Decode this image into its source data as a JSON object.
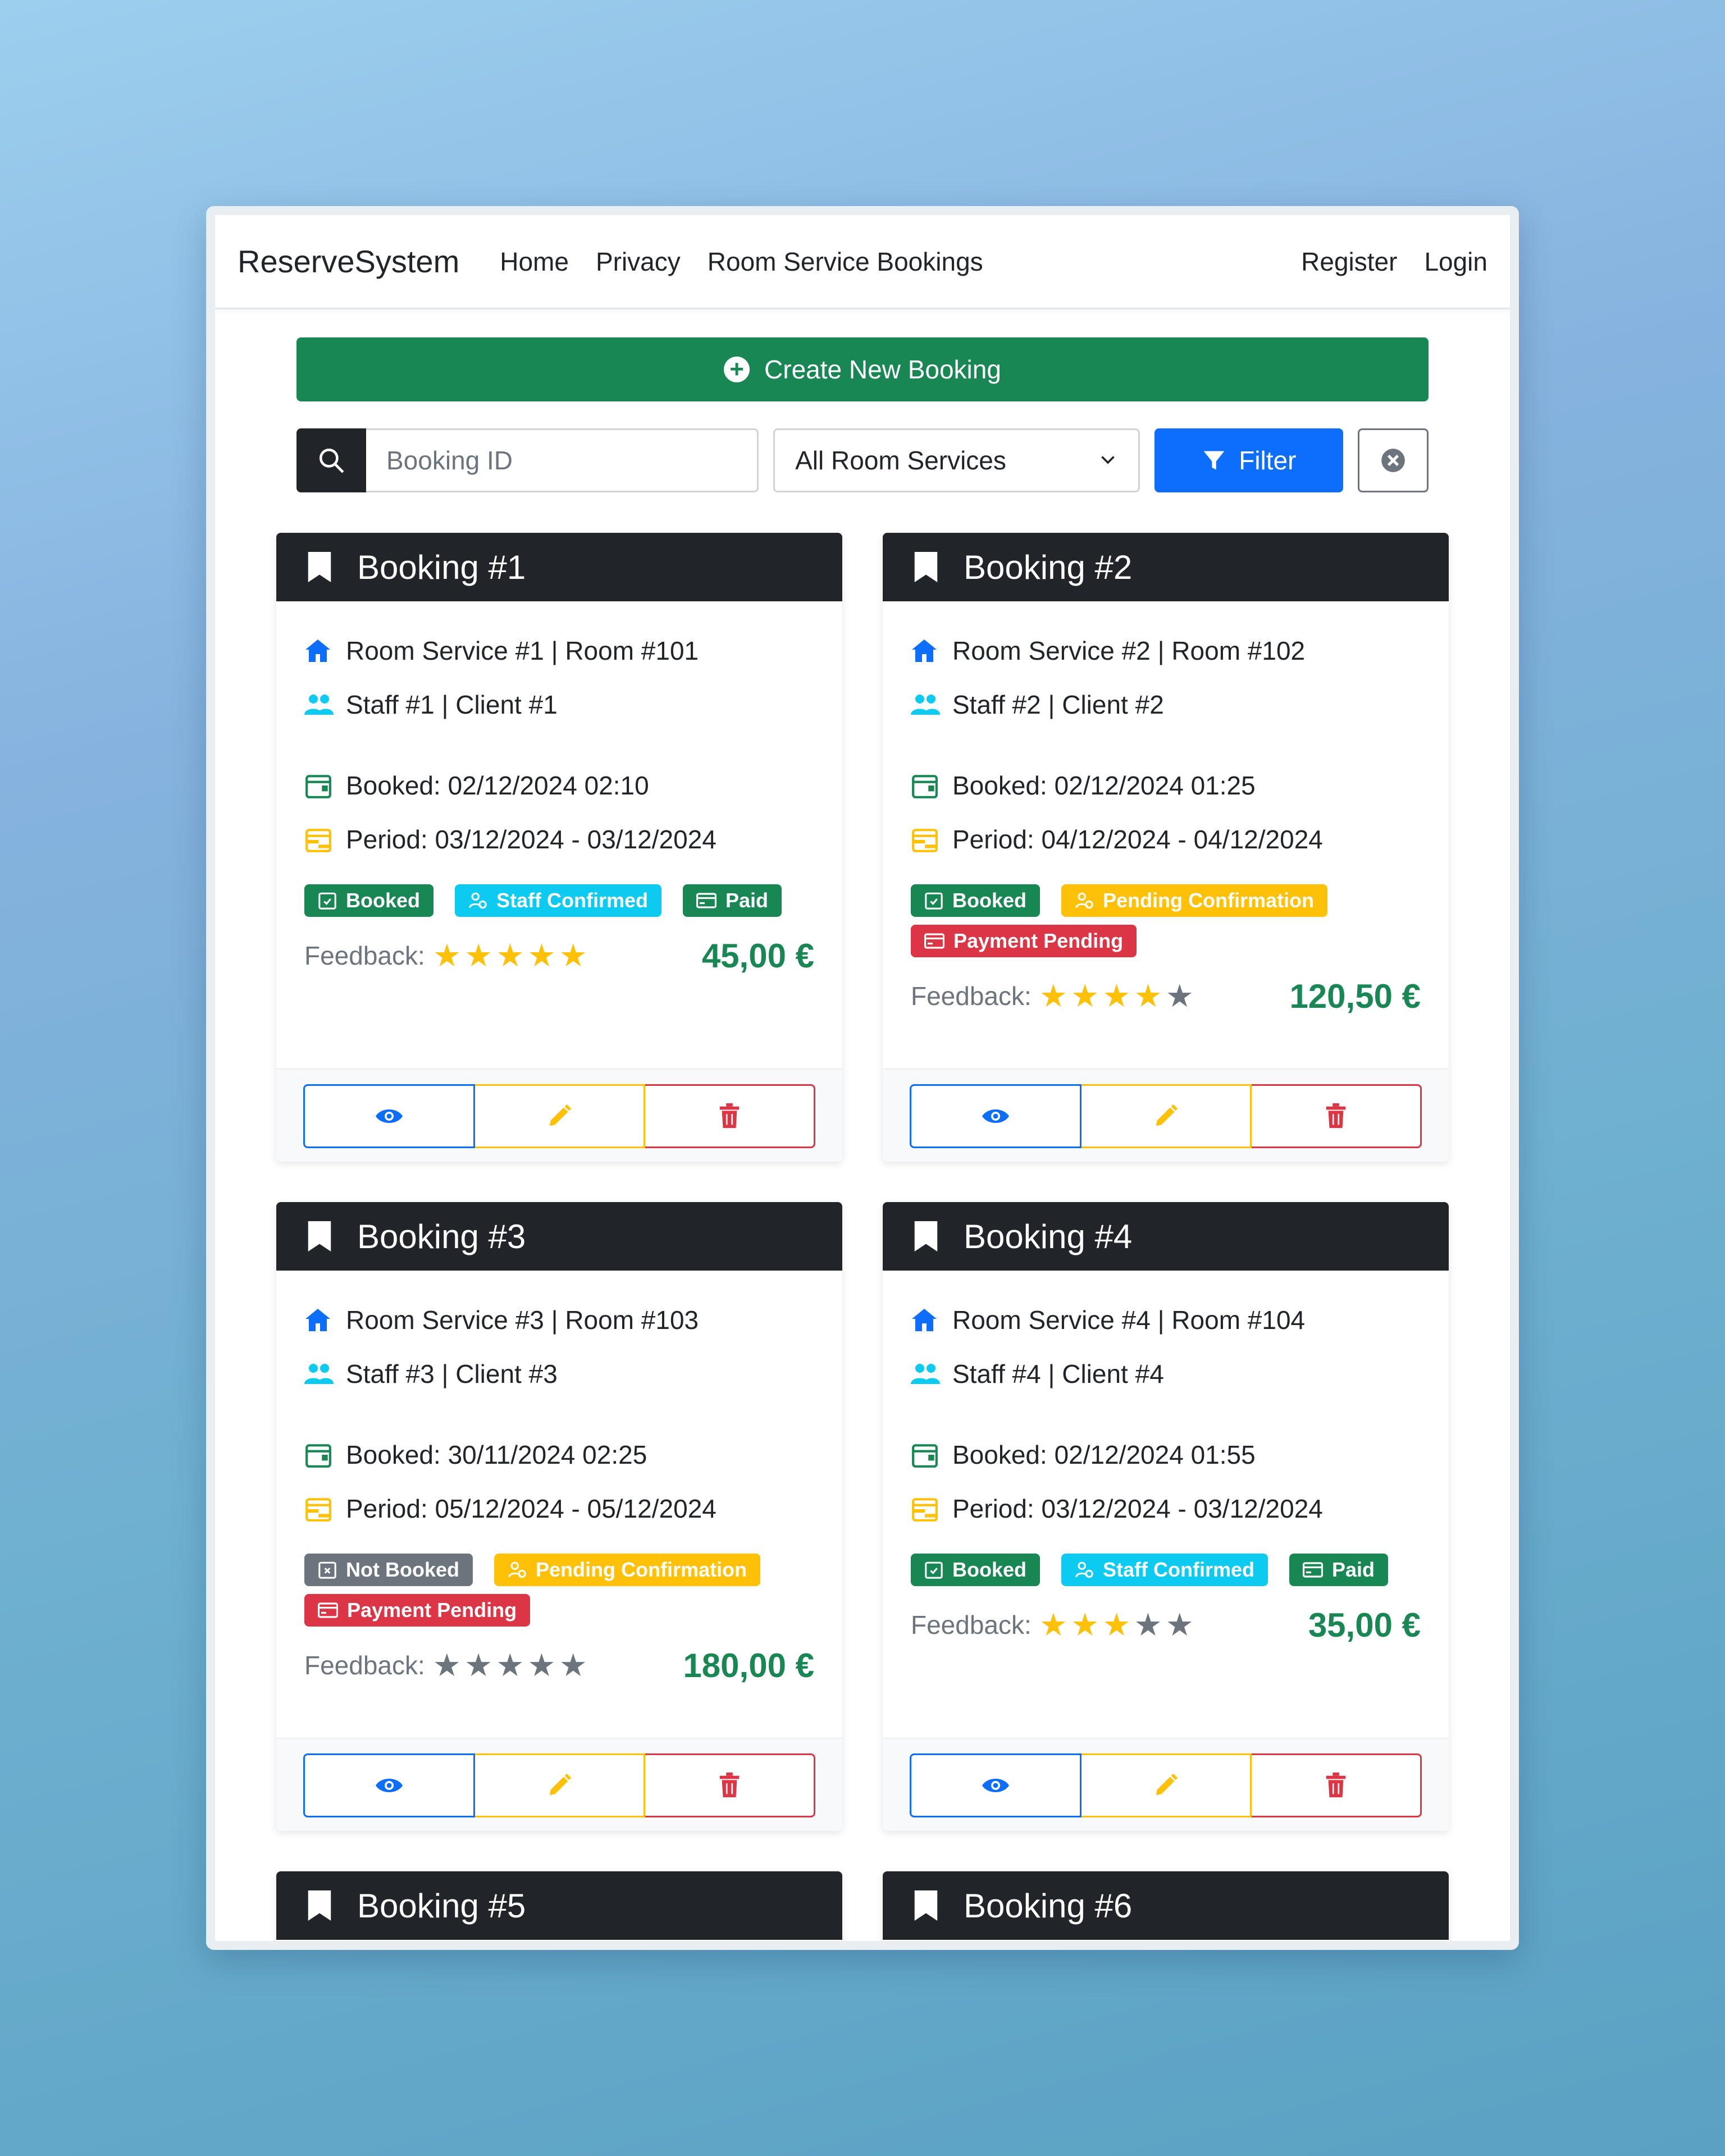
{
  "navbar": {
    "brand": "ReserveSystem",
    "links": [
      "Home",
      "Privacy",
      "Room Service Bookings"
    ],
    "right_links": [
      "Register",
      "Login"
    ]
  },
  "actions": {
    "create_label": "Create New Booking"
  },
  "filters": {
    "search_placeholder": "Booking ID",
    "search_value": "",
    "room_service_selected": "All Room Services",
    "filter_label": "Filter"
  },
  "feedback_label": "Feedback:",
  "colors": {
    "primary": "#0d6efd",
    "success": "#198754",
    "warning": "#ffc107",
    "danger": "#dc3545",
    "info": "#0dcaf0",
    "dark": "#212529",
    "secondary": "#6c757d"
  },
  "bookings": [
    {
      "title": "Booking #1",
      "service_room": "Room Service #1 | Room #101",
      "staff_client": "Staff #1 | Client #1",
      "booked": "Booked: 02/12/2024 02:10",
      "period": "Period: 03/12/2024 - 03/12/2024",
      "badges": [
        {
          "label": "Booked",
          "color": "green",
          "icon": "calendar-check-icon"
        },
        {
          "label": "Staff Confirmed",
          "color": "cyan",
          "icon": "person-check-icon"
        },
        {
          "label": "Paid",
          "color": "green",
          "icon": "credit-card-icon"
        }
      ],
      "rating": 5,
      "price": "45,00 €"
    },
    {
      "title": "Booking #2",
      "service_room": "Room Service #2 | Room #102",
      "staff_client": "Staff #2 | Client #2",
      "booked": "Booked: 02/12/2024 01:25",
      "period": "Period: 04/12/2024 - 04/12/2024",
      "badges": [
        {
          "label": "Booked",
          "color": "green",
          "icon": "calendar-check-icon"
        },
        {
          "label": "Pending Confirmation",
          "color": "yellow",
          "icon": "person-clock-icon"
        },
        {
          "label": "Payment Pending",
          "color": "red",
          "icon": "credit-card-icon"
        }
      ],
      "rating": 4,
      "price": "120,50 €"
    },
    {
      "title": "Booking #3",
      "service_room": "Room Service #3 | Room #103",
      "staff_client": "Staff #3 | Client #3",
      "booked": "Booked: 30/11/2024 02:25",
      "period": "Period: 05/12/2024 - 05/12/2024",
      "badges": [
        {
          "label": "Not Booked",
          "color": "gray",
          "icon": "calendar-x-icon"
        },
        {
          "label": "Pending Confirmation",
          "color": "yellow",
          "icon": "person-clock-icon"
        },
        {
          "label": "Payment Pending",
          "color": "red",
          "icon": "credit-card-icon"
        }
      ],
      "rating": 0,
      "price": "180,00 €"
    },
    {
      "title": "Booking #4",
      "service_room": "Room Service #4 | Room #104",
      "staff_client": "Staff #4 | Client #4",
      "booked": "Booked: 02/12/2024 01:55",
      "period": "Period: 03/12/2024 - 03/12/2024",
      "badges": [
        {
          "label": "Booked",
          "color": "green",
          "icon": "calendar-check-icon"
        },
        {
          "label": "Staff Confirmed",
          "color": "cyan",
          "icon": "person-check-icon"
        },
        {
          "label": "Paid",
          "color": "green",
          "icon": "credit-card-icon"
        }
      ],
      "rating": 3,
      "price": "35,00 €"
    },
    {
      "title": "Booking #5"
    },
    {
      "title": "Booking #6"
    }
  ]
}
